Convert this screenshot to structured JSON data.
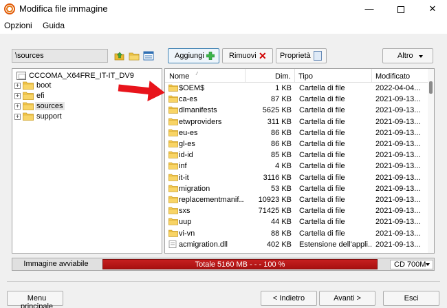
{
  "window": {
    "title": "Modifica file immagine",
    "controls": {
      "minimize": "—",
      "close": "✕"
    }
  },
  "menu": {
    "items": [
      "Opzioni",
      "Guida"
    ]
  },
  "toolbar": {
    "path": "\\sources",
    "buttons": {
      "add": "Aggiungi",
      "remove": "Rimuovi",
      "properties": "Proprietà",
      "more": "Altro"
    }
  },
  "tree": {
    "root": "CCCOMA_X64FRE_IT-IT_DV9",
    "items": [
      {
        "label": "boot"
      },
      {
        "label": "efi"
      },
      {
        "label": "sources",
        "selected": true
      },
      {
        "label": "support"
      }
    ],
    "expander_glyph": "+"
  },
  "list": {
    "columns": {
      "name": "Nome",
      "size": "Dim.",
      "type": "Tipo",
      "modified": "Modificato"
    },
    "rows": [
      {
        "name": "$OEM$",
        "size": "1 KB",
        "type": "Cartella di file",
        "modified": "2022-04-04..."
      },
      {
        "name": "ca-es",
        "size": "87 KB",
        "type": "Cartella di file",
        "modified": "2021-09-13..."
      },
      {
        "name": "dlmanifests",
        "size": "5625 KB",
        "type": "Cartella di file",
        "modified": "2021-09-13..."
      },
      {
        "name": "etwproviders",
        "size": "311 KB",
        "type": "Cartella di file",
        "modified": "2021-09-13..."
      },
      {
        "name": "eu-es",
        "size": "86 KB",
        "type": "Cartella di file",
        "modified": "2021-09-13..."
      },
      {
        "name": "gl-es",
        "size": "86 KB",
        "type": "Cartella di file",
        "modified": "2021-09-13..."
      },
      {
        "name": "id-id",
        "size": "85 KB",
        "type": "Cartella di file",
        "modified": "2021-09-13..."
      },
      {
        "name": "inf",
        "size": "4 KB",
        "type": "Cartella di file",
        "modified": "2021-09-13..."
      },
      {
        "name": "it-it",
        "size": "3116 KB",
        "type": "Cartella di file",
        "modified": "2021-09-13..."
      },
      {
        "name": "migration",
        "size": "53 KB",
        "type": "Cartella di file",
        "modified": "2021-09-13..."
      },
      {
        "name": "replacementmanif...",
        "size": "10923 KB",
        "type": "Cartella di file",
        "modified": "2021-09-13..."
      },
      {
        "name": "sxs",
        "size": "71425 KB",
        "type": "Cartella di file",
        "modified": "2021-09-13..."
      },
      {
        "name": "uup",
        "size": "44 KB",
        "type": "Cartella di file",
        "modified": "2021-09-13..."
      },
      {
        "name": "vi-vn",
        "size": "88 KB",
        "type": "Cartella di file",
        "modified": "2021-09-13..."
      },
      {
        "name": "acmigration.dll",
        "size": "402 KB",
        "type": "Estensione dell'appli...",
        "modified": "2021-09-13..."
      }
    ]
  },
  "status": {
    "label": "Immagine avviabile",
    "progress_text": "Totale 5160 MB  - - -  100 %",
    "progress_percent": 100,
    "media": "CD 700M"
  },
  "footer": {
    "main_menu": "Menu principale",
    "back": "< Indietro",
    "next": "Avanti >",
    "exit": "Esci"
  },
  "colors": {
    "progress_red": "#b71717",
    "folder_yellow": "#f5c84c",
    "arrow_red": "#e8141b"
  }
}
